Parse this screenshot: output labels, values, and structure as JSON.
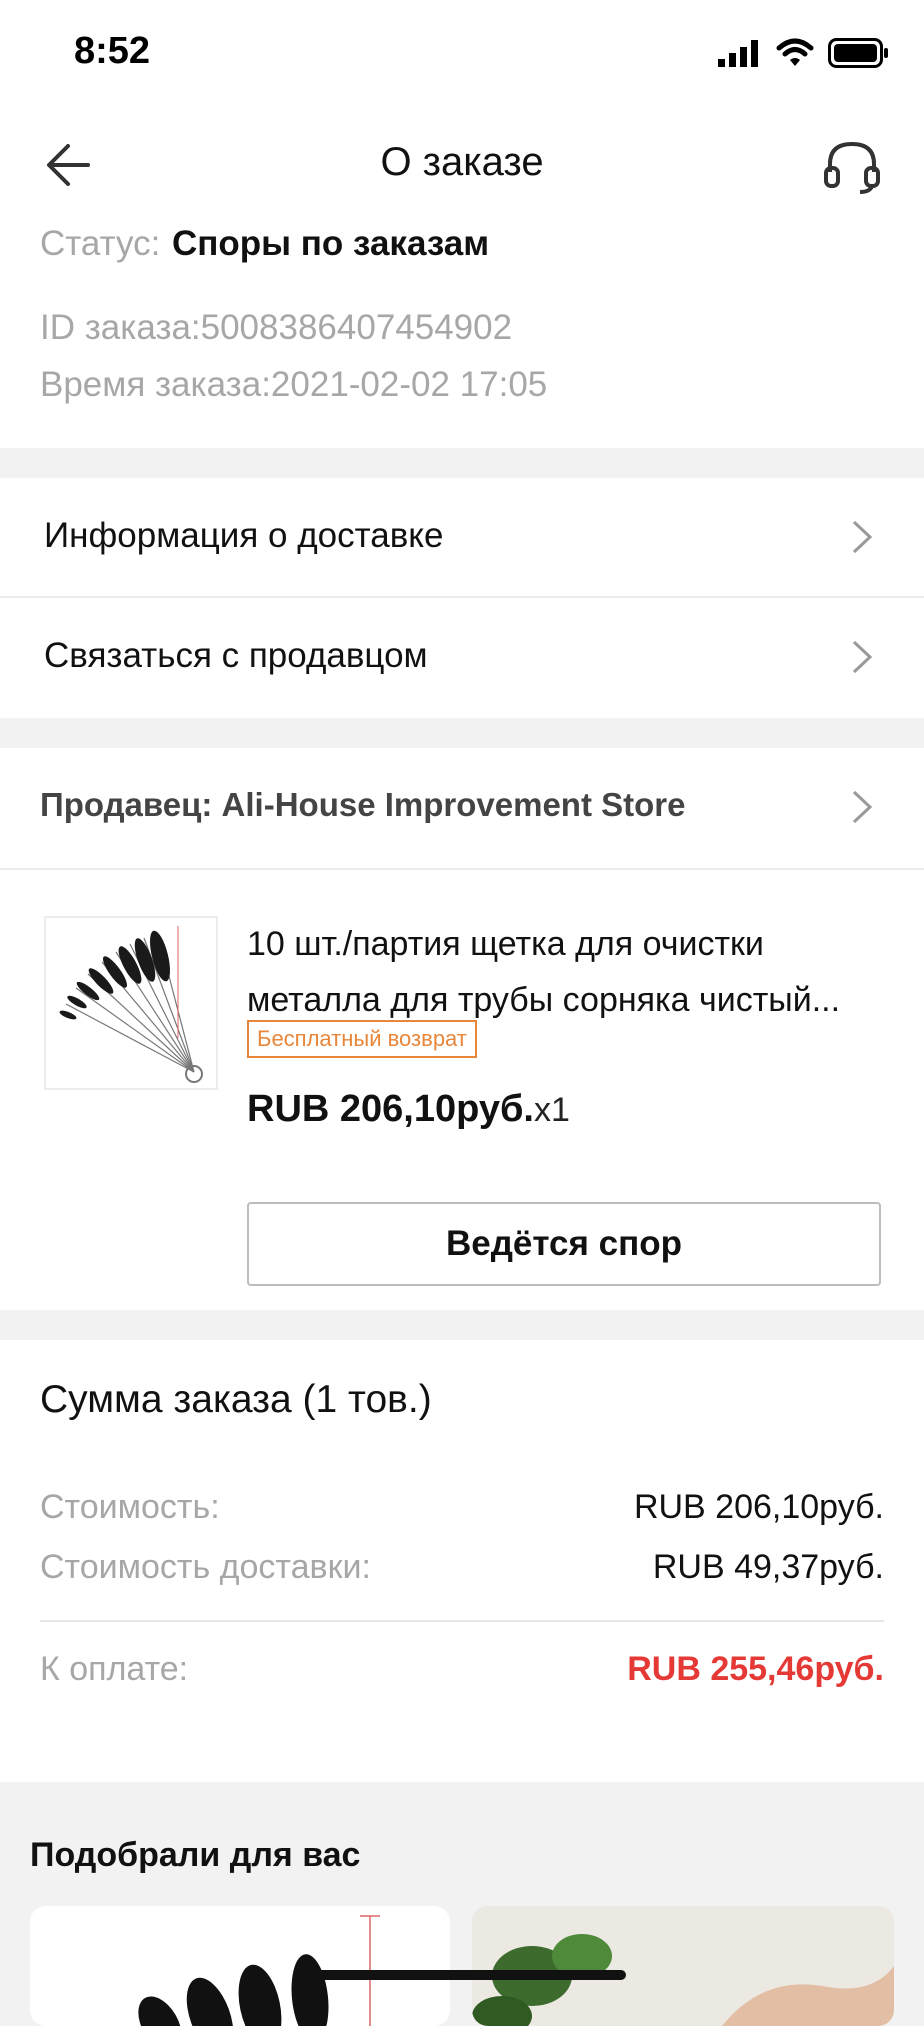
{
  "status_bar": {
    "time": "8:52"
  },
  "header": {
    "title": "О заказе"
  },
  "order": {
    "status_label": "Статус:",
    "status_value": "Споры по заказам",
    "id_line": "ID заказа:5008386407454902",
    "time_line": "Время заказа:2021-02-02 17:05"
  },
  "menu": [
    {
      "label": "Информация о доставке"
    },
    {
      "label": "Связаться с продавцом"
    }
  ],
  "seller": {
    "name": "Продавец: Ali-House Improvement Store"
  },
  "product": {
    "title": "10 шт./партия щетка для очистки металла для трубы сорняка чистый...",
    "badge": "Бесплатный возврат",
    "price": "RUB 206,10руб.",
    "qty": "x1",
    "dispute_button": "Ведётся спор"
  },
  "summary": {
    "title": "Сумма заказа (1 тов.)",
    "cost_label": "Стоимость:",
    "cost_value": "RUB 206,10руб.",
    "shipping_label": "Стоимость доставки:",
    "shipping_value": "RUB 49,37руб.",
    "pay_label": "К оплате:",
    "pay_value": "RUB 255,46руб.",
    "pay_color": "#e53935"
  },
  "recommendations": {
    "title": "Подобрали для вас"
  },
  "icons": [
    "signal-icon",
    "wifi-icon",
    "battery-icon",
    "back-arrow-icon",
    "headset-icon",
    "chevron-right-icon"
  ]
}
